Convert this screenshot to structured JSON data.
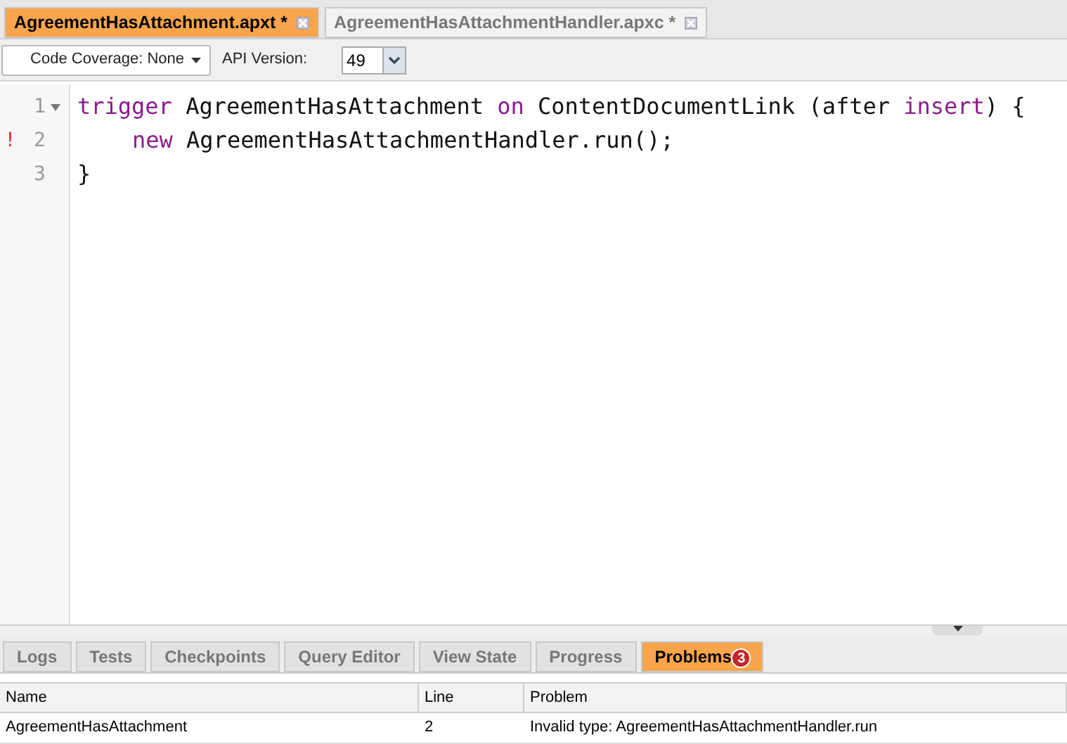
{
  "file_tabs": [
    {
      "label": "AgreementHasAttachment.apxt *",
      "selected": true
    },
    {
      "label": "AgreementHasAttachmentHandler.apxc *",
      "selected": false
    }
  ],
  "toolbar": {
    "code_coverage": "Code Coverage: None",
    "api_label": "API Version:",
    "api_version": "49"
  },
  "editor": {
    "lines": [
      {
        "number": "1",
        "fold": true,
        "error": false,
        "indent": false,
        "tokens": [
          {
            "text": "trigger",
            "kind": "keyword"
          },
          {
            "text": " AgreementHasAttachment ",
            "kind": "plain"
          },
          {
            "text": "on",
            "kind": "keyword"
          },
          {
            "text": " ContentDocumentLink (after ",
            "kind": "plain"
          },
          {
            "text": "insert",
            "kind": "keyword"
          },
          {
            "text": ") {",
            "kind": "plain"
          }
        ]
      },
      {
        "number": "2",
        "fold": false,
        "error": true,
        "indent": true,
        "tokens": [
          {
            "text": "new",
            "kind": "keyword"
          },
          {
            "text": " AgreementHasAttachmentHandler.run();",
            "kind": "plain"
          }
        ]
      },
      {
        "number": "3",
        "fold": false,
        "error": false,
        "indent": false,
        "tokens": [
          {
            "text": "}",
            "kind": "plain"
          }
        ]
      }
    ],
    "error_mark": "!"
  },
  "bottom_tabs": [
    {
      "label": "Logs",
      "selected": false
    },
    {
      "label": "Tests",
      "selected": false
    },
    {
      "label": "Checkpoints",
      "selected": false
    },
    {
      "label": "Query Editor",
      "selected": false
    },
    {
      "label": "View State",
      "selected": false
    },
    {
      "label": "Progress",
      "selected": false
    },
    {
      "label": "Problems",
      "selected": true,
      "badge": "3"
    }
  ],
  "problems_table": {
    "columns": [
      "Name",
      "Line",
      "Problem"
    ],
    "rows": [
      [
        "AgreementHasAttachment",
        "2",
        "Invalid type: AgreementHasAttachmentHandler.run"
      ]
    ]
  }
}
